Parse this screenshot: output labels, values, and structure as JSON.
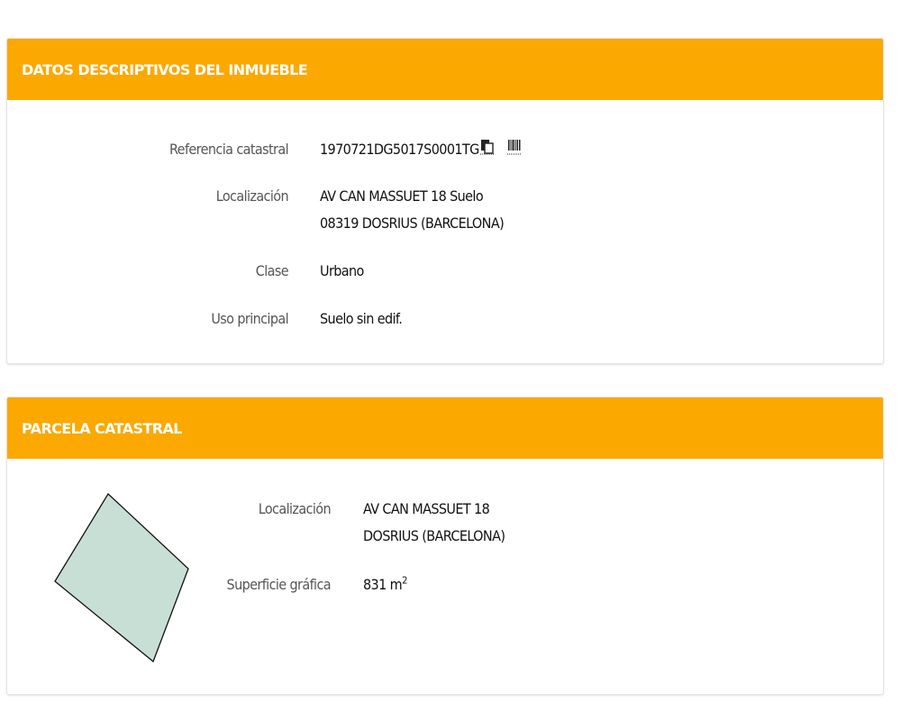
{
  "datos": {
    "title": "DATOS DESCRIPTIVOS DEL INMUEBLE",
    "referencia_label": "Referencia catastral",
    "referencia_value": "1970721DG5017S0001TG",
    "copy_icon": "copy-document-icon",
    "barcode_icon": "barcode-icon",
    "localizacion_label": "Localización",
    "localizacion_line1": "AV CAN MASSUET 18 Suelo",
    "localizacion_line2": "08319 DOSRIUS (BARCELONA)",
    "clase_label": "Clase",
    "clase_value": "Urbano",
    "uso_label": "Uso principal",
    "uso_value": "Suelo sin edif."
  },
  "parcela": {
    "title": "PARCELA CATASTRAL",
    "localizacion_label": "Localización",
    "localizacion_line1": "AV CAN MASSUET 18",
    "localizacion_line2": "DOSRIUS (BARCELONA)",
    "superficie_label": "Superficie gráfica",
    "superficie_value": "831 m",
    "superficie_unit_exp": "2",
    "parcel_fill": "#c8dfd6"
  },
  "colors": {
    "header": "#fba800",
    "header_text": "#ffffff"
  }
}
